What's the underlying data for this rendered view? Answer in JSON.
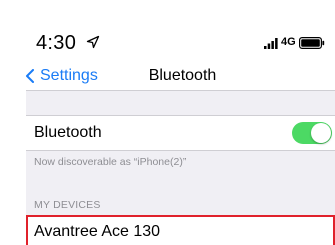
{
  "status_bar": {
    "time": "4:30",
    "network": "4G",
    "icons": [
      "location-arrow-icon",
      "signal-bars-icon",
      "battery-icon"
    ]
  },
  "nav": {
    "back_label": "Settings",
    "title": "Bluetooth"
  },
  "bluetooth": {
    "label": "Bluetooth",
    "enabled": true,
    "discoverable_text": "Now discoverable as “iPhone(2)”"
  },
  "devices": {
    "header": "MY DEVICES",
    "items": [
      {
        "name": "Avantree Ace 130"
      }
    ]
  },
  "colors": {
    "accent": "#1a7cf6",
    "toggle_on": "#4cd964",
    "highlight_border": "#e0212b",
    "grouped_background": "#f0eff4",
    "secondary_text": "#8e8e93"
  }
}
